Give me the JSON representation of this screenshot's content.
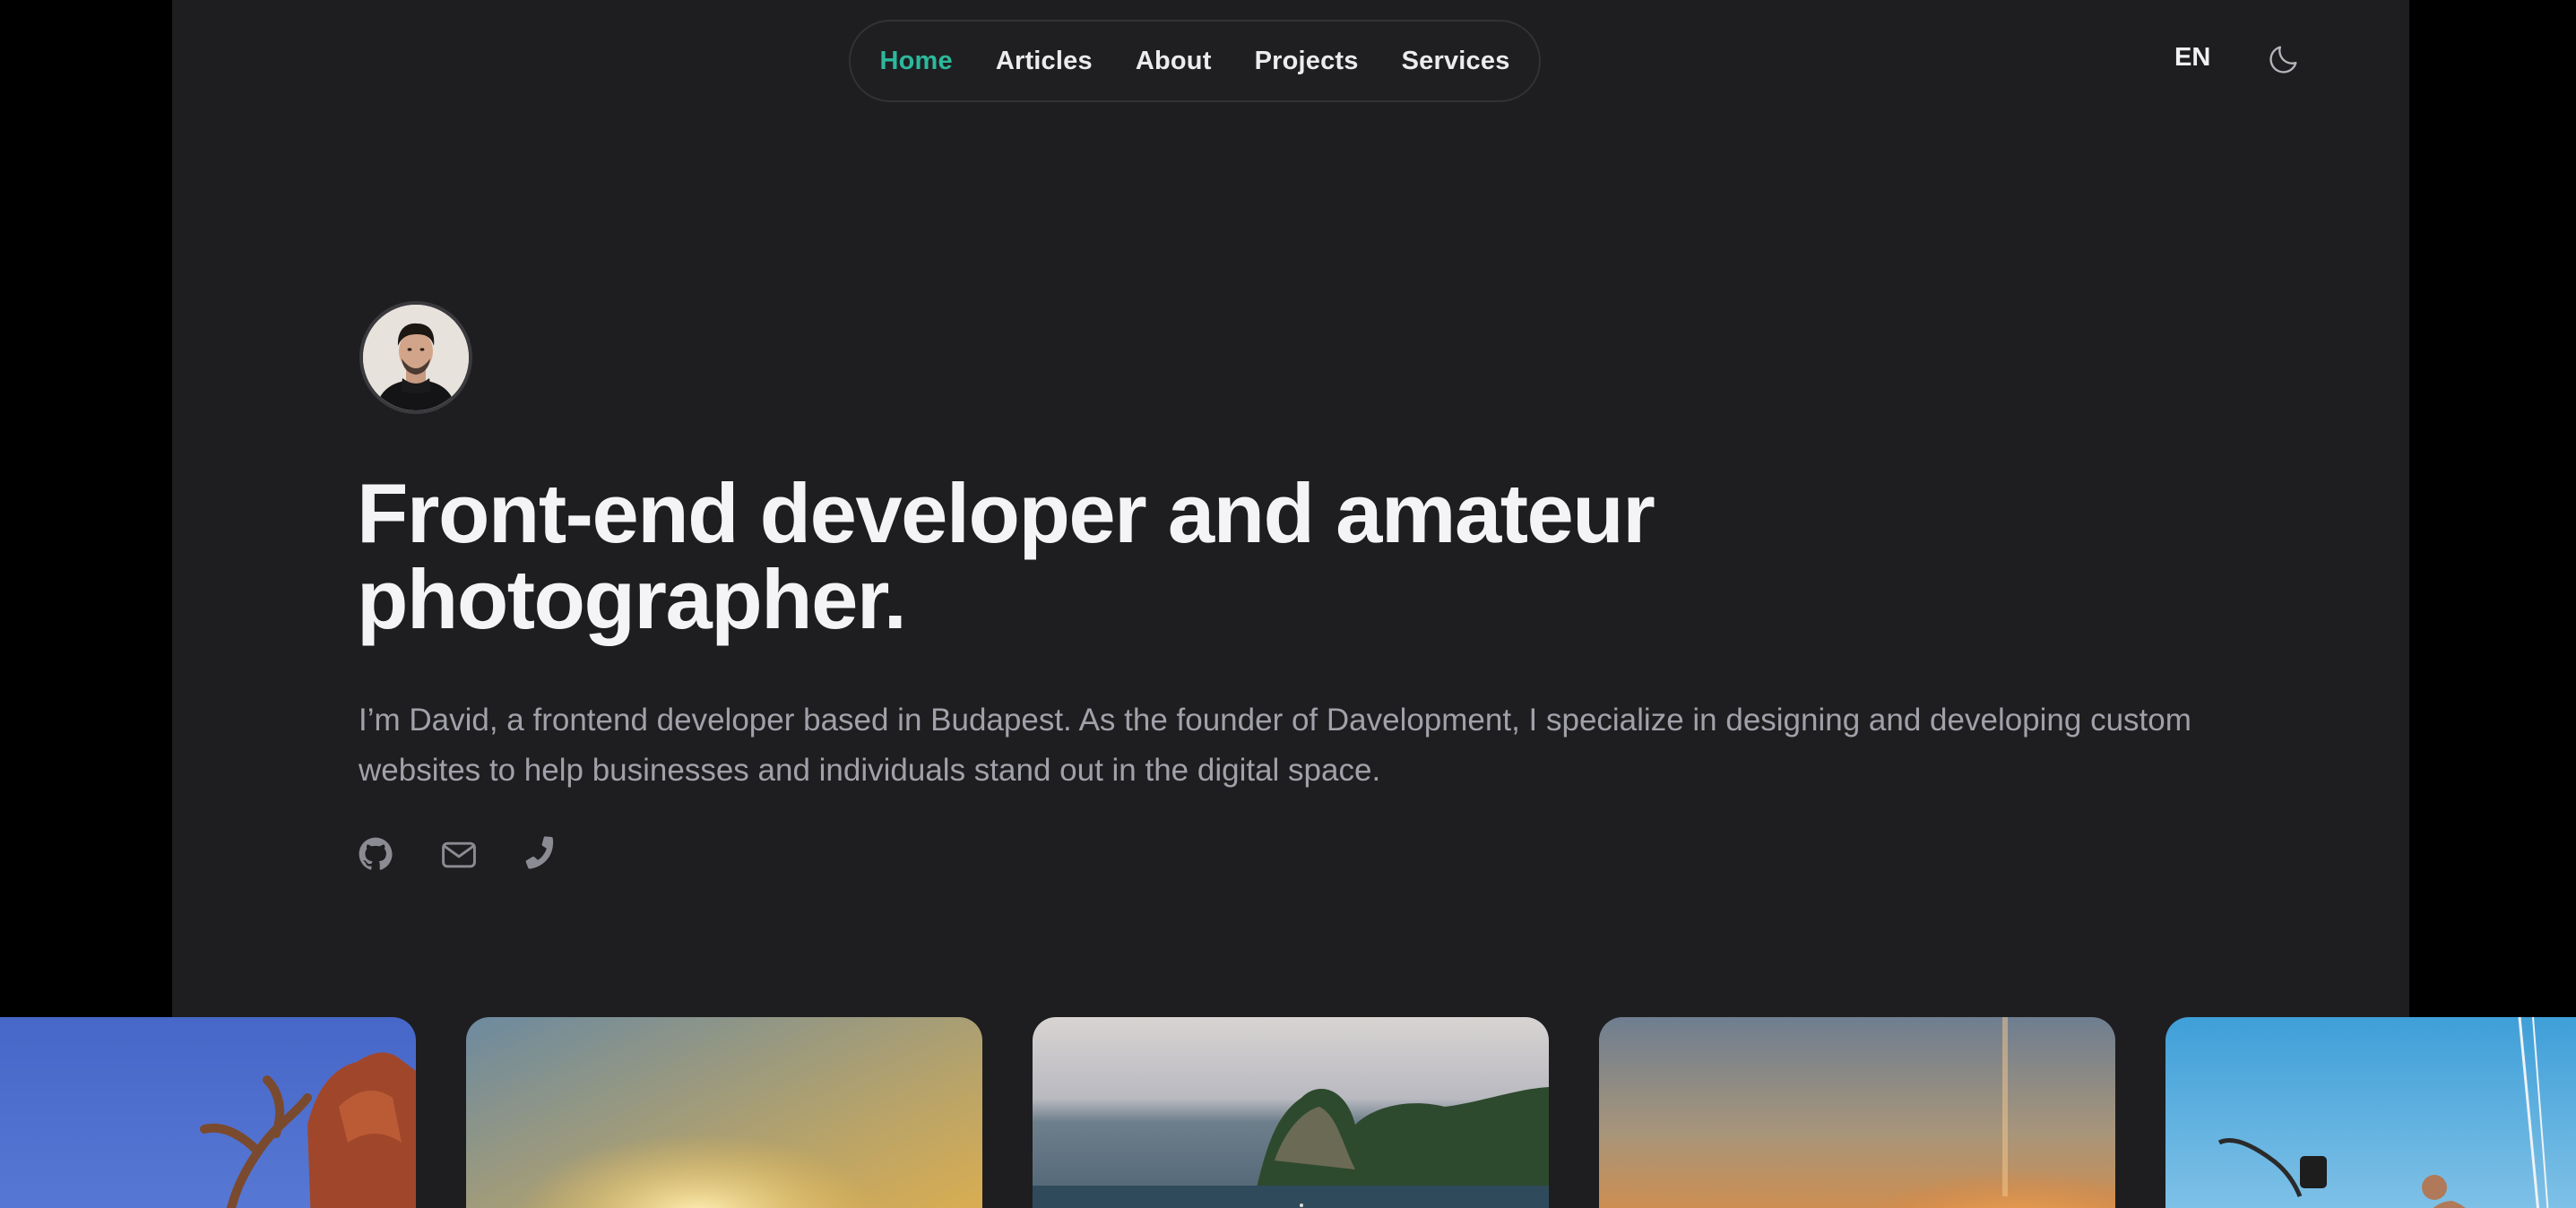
{
  "nav": {
    "items": [
      {
        "label": "Home",
        "active": true
      },
      {
        "label": "Articles",
        "active": false
      },
      {
        "label": "About",
        "active": false
      },
      {
        "label": "Projects",
        "active": false
      },
      {
        "label": "Services",
        "active": false
      }
    ],
    "language": "EN",
    "theme_icon": "moon-icon"
  },
  "hero": {
    "title": "Front-end developer and amateur photographer.",
    "description": "I’m David, a frontend developer based in Budapest. As the founder of Davelopment, I specialize in designing and developing custom websites to help businesses and individuals stand out in the digital space.",
    "social_icons": [
      "github-icon",
      "mail-icon",
      "phone-icon"
    ]
  },
  "photos": [
    "desert-rocks",
    "sunset-sea",
    "tropical-island",
    "sunset-sky",
    "sailing-boat"
  ],
  "colors": {
    "accent": "#2db89c",
    "background": "#1e1e20",
    "outer": "#000000",
    "text": "#f4f4f6",
    "muted": "#a1a1aa"
  }
}
